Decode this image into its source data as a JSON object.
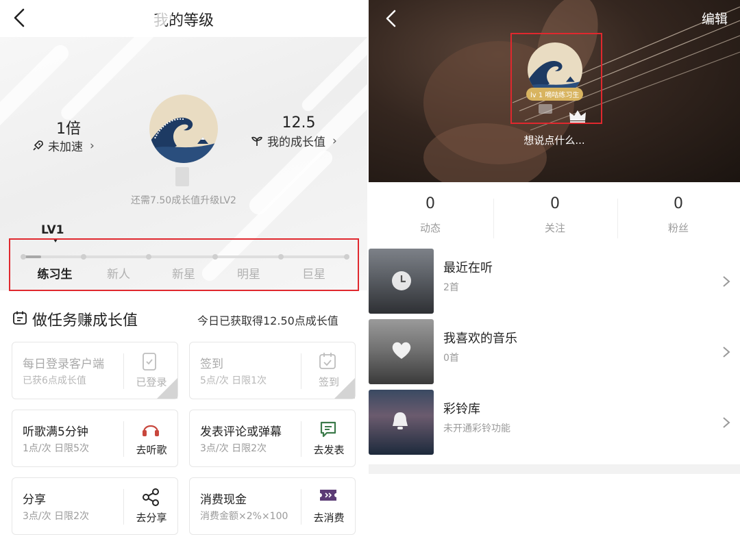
{
  "left": {
    "title": "我的等级",
    "speed": {
      "value": "1倍",
      "label": "未加速"
    },
    "growth": {
      "value": "12.5",
      "label": "我的成长值"
    },
    "need_text": "还需7.50成长值升级LV2",
    "current_level_marker": "LV1",
    "levels": [
      {
        "name": "练习生",
        "active": true
      },
      {
        "name": "新人",
        "active": false
      },
      {
        "name": "新星",
        "active": false
      },
      {
        "name": "明星",
        "active": false
      },
      {
        "name": "巨星",
        "active": false
      }
    ],
    "level_progress": 0.3,
    "tasks_heading": "做任务赚成长值",
    "today_earned": "今日已获取得12.50点成长值",
    "tasks": [
      {
        "title": "每日登录客户端",
        "sub": "已获6点成长值",
        "action": "已登录",
        "icon": "phone-check-icon",
        "done": true
      },
      {
        "title": "签到",
        "sub": "5点/次 日限1次",
        "action": "签到",
        "icon": "calendar-check-icon",
        "done": true
      },
      {
        "title": "听歌满5分钟",
        "sub": "1点/次 日限5次",
        "action": "去听歌",
        "icon": "headphones-icon",
        "done": false
      },
      {
        "title": "发表评论或弹幕",
        "sub": "3点/次 日限2次",
        "action": "去发表",
        "icon": "comment-icon",
        "done": false
      },
      {
        "title": "分享",
        "sub": "3点/次 日限2次",
        "action": "去分享",
        "icon": "share-icon",
        "done": false
      },
      {
        "title": "消费现金",
        "sub": "消费金额×2%×100",
        "action": "去消费",
        "icon": "ticket-icon",
        "done": false
      }
    ]
  },
  "right": {
    "edit_label": "编辑",
    "level_badge": "lv 1 嘀咕练习生",
    "signature": "想说点什么...",
    "stats": [
      {
        "value": "0",
        "label": "动态"
      },
      {
        "value": "0",
        "label": "关注"
      },
      {
        "value": "0",
        "label": "粉丝"
      }
    ],
    "rows": [
      {
        "title": "最近在听",
        "sub": "2首",
        "icon": "clock-icon"
      },
      {
        "title": "我喜欢的音乐",
        "sub": "0首",
        "icon": "heart-icon"
      },
      {
        "title": "彩铃库",
        "sub": "未开通彩铃功能",
        "icon": "bell-icon"
      }
    ]
  },
  "colors": {
    "highlight_box": "#e0282e",
    "badge": "#d8b460",
    "growth_icon": "#c8473d",
    "green_icon": "#3b7a4a",
    "purple_icon": "#5b3b75"
  }
}
